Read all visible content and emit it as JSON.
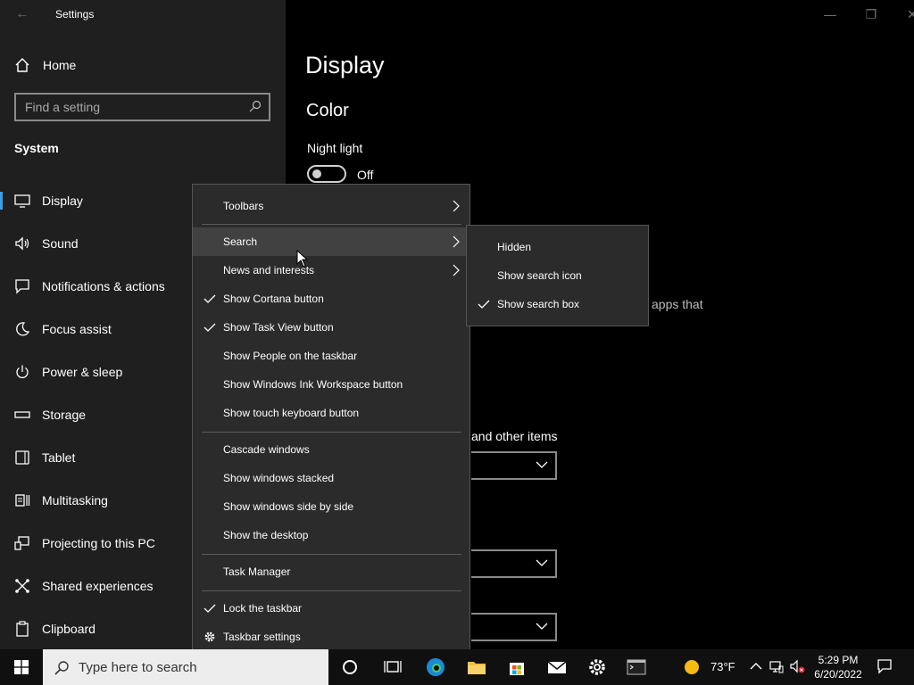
{
  "window": {
    "title": "Settings",
    "back_glyph": "←",
    "minimize_glyph": "—",
    "maximize_glyph": "❐",
    "close_glyph": "✕"
  },
  "sidebar": {
    "home_label": "Home",
    "search_placeholder": "Find a setting",
    "section_label": "System",
    "items": [
      {
        "label": "Display",
        "icon": "monitor-icon",
        "active": true
      },
      {
        "label": "Sound",
        "icon": "speaker-icon"
      },
      {
        "label": "Notifications & actions",
        "icon": "notification-icon"
      },
      {
        "label": "Focus assist",
        "icon": "moon-icon"
      },
      {
        "label": "Power & sleep",
        "icon": "power-icon"
      },
      {
        "label": "Storage",
        "icon": "storage-icon"
      },
      {
        "label": "Tablet",
        "icon": "tablet-icon"
      },
      {
        "label": "Multitasking",
        "icon": "multitasking-icon"
      },
      {
        "label": "Projecting to this PC",
        "icon": "projecting-icon"
      },
      {
        "label": "Shared experiences",
        "icon": "shared-icon"
      },
      {
        "label": "Clipboard",
        "icon": "clipboard-icon"
      }
    ]
  },
  "main": {
    "page_title": "Display",
    "color_heading": "Color",
    "night_light_label": "Night light",
    "night_light_state": "Off",
    "partial_text_1": "apps that",
    "partial_text_2": "and other items"
  },
  "context_menu": {
    "toolbars": "Toolbars",
    "search": "Search",
    "news": "News and interests",
    "cortana": "Show Cortana button",
    "task_view": "Show Task View button",
    "people": "Show People on the taskbar",
    "ink": "Show Windows Ink Workspace button",
    "keyboard": "Show touch keyboard button",
    "cascade": "Cascade windows",
    "stacked": "Show windows stacked",
    "side_by_side": "Show windows side by side",
    "desktop": "Show the desktop",
    "task_manager": "Task Manager",
    "lock": "Lock the taskbar",
    "settings": "Taskbar settings"
  },
  "search_submenu": {
    "hidden": "Hidden",
    "icon": "Show search icon",
    "box": "Show search box",
    "selected": "Show search box"
  },
  "taskbar": {
    "search_placeholder": "Type here to search",
    "weather_temp": "73°F",
    "time": "5:29 PM",
    "date": "6/20/2022"
  },
  "colors": {
    "accent": "#3a9ee6",
    "sidebar_bg": "#1f1f1f",
    "menu_bg": "#2b2b2b"
  }
}
